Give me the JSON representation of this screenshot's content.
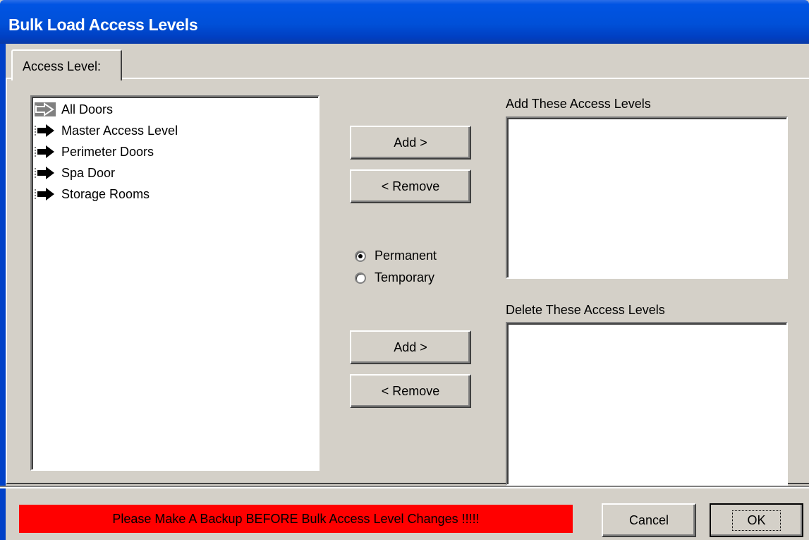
{
  "window": {
    "title": "Bulk Load Access Levels"
  },
  "tab": {
    "label": "Access Level:"
  },
  "source_list": {
    "items": [
      {
        "label": "All Doors",
        "icon": "arrow-right-outline-icon",
        "selected": true
      },
      {
        "label": "Master Access Level",
        "icon": "arrow-right-icon"
      },
      {
        "label": "Perimeter Doors",
        "icon": "arrow-right-icon"
      },
      {
        "label": "Spa Door",
        "icon": "arrow-right-icon"
      },
      {
        "label": "Storage Rooms",
        "icon": "arrow-right-icon"
      }
    ]
  },
  "add_group": {
    "label": "Add These Access Levels",
    "add_button": "Add >",
    "remove_button": "< Remove"
  },
  "mode": {
    "options": [
      {
        "label": "Permanent",
        "selected": true
      },
      {
        "label": "Temporary",
        "selected": false
      }
    ]
  },
  "delete_group": {
    "label": "Delete These Access Levels",
    "add_button": "Add >",
    "remove_button": "< Remove"
  },
  "footer": {
    "warning": "Please Make A Backup BEFORE Bulk Access Level Changes !!!!!",
    "cancel": "Cancel",
    "ok": "OK"
  },
  "colors": {
    "titlebar": "#0054e3",
    "warning_bg": "#ff0000",
    "face": "#d4d0c8"
  }
}
